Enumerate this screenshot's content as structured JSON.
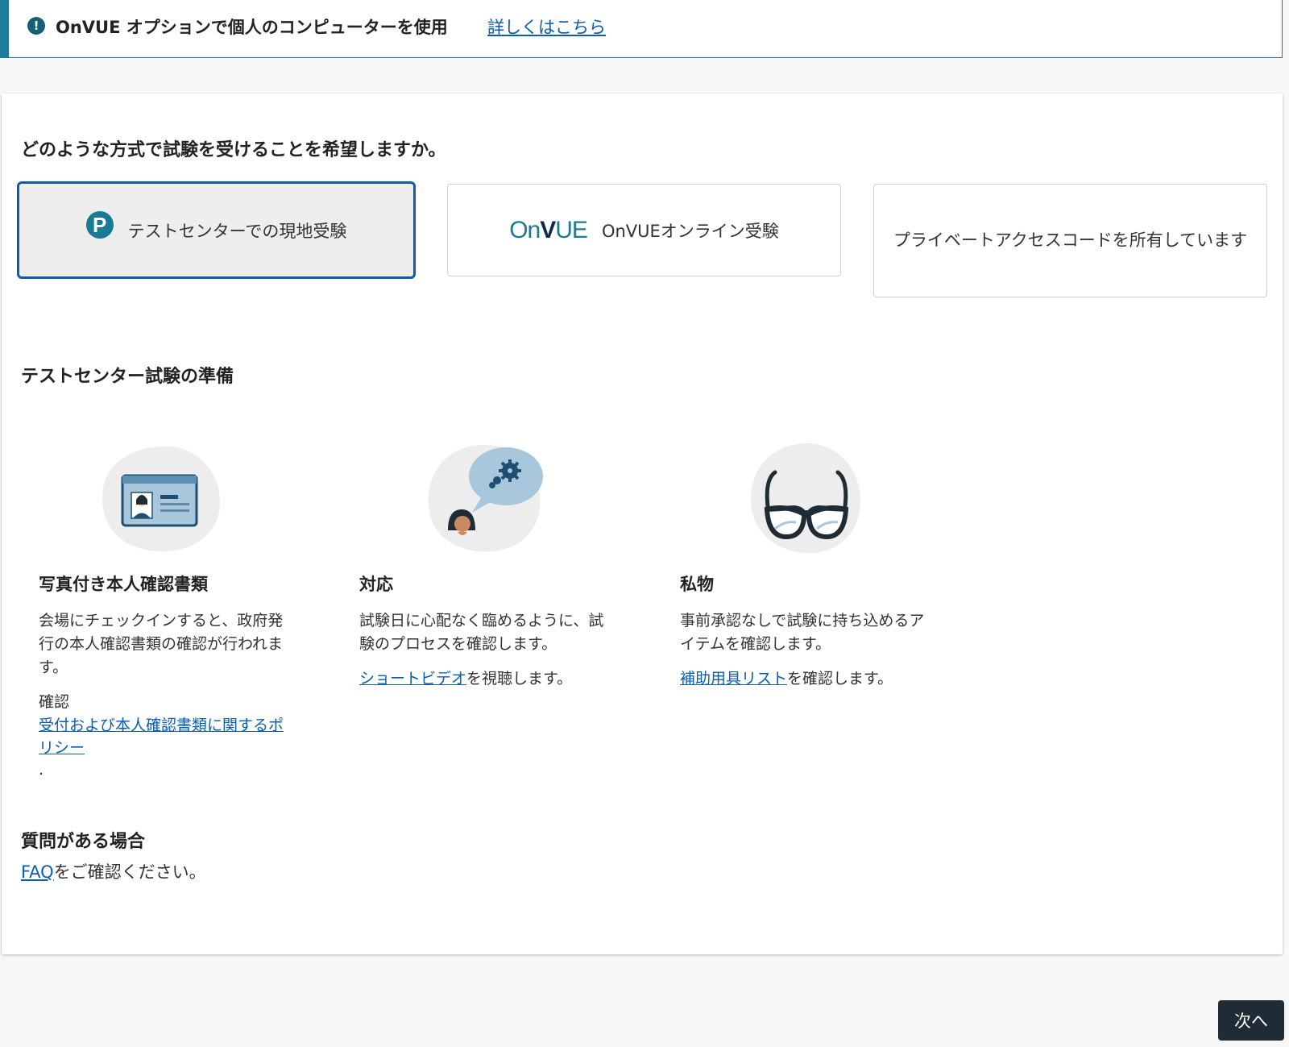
{
  "banner": {
    "text": "OnVUE オプションで個人のコンピューターを使用",
    "link": "詳しくはこちら",
    "icon": "exclamation-icon"
  },
  "question": "どのような方式で試験を受けることを希望しますか。",
  "options": [
    {
      "label": "テストセンターでの現地受験",
      "logo": "P",
      "selected": true
    },
    {
      "label": "OnVUEオンライン受験",
      "logo": "OnVUE",
      "selected": false
    },
    {
      "label": "プライベートアクセスコードを所有しています",
      "selected": false
    }
  ],
  "prep": {
    "title": "テストセンター試験の準備",
    "items": [
      {
        "icon": "id-card-icon",
        "title": "写真付き本人確認書類",
        "desc": "会場にチェックインすると、政府発行の本人確認書類の確認が行われます。",
        "confirm": "確認",
        "link": "受付および本人確認書類に関するポリシー",
        "after": "."
      },
      {
        "icon": "person-thinking-icon",
        "title": "対応",
        "desc": "試験日に心配なく臨めるように、試験のプロセスを確認します。",
        "link": "ショートビデオ",
        "after": "を視聴します。"
      },
      {
        "icon": "glasses-icon",
        "title": "私物",
        "desc": "事前承認なしで試験に持ち込めるアイテムを確認します。",
        "link": "補助用具リスト",
        "after": "を確認します。"
      }
    ]
  },
  "faq": {
    "title": "質問がある場合",
    "link": "FAQ",
    "after": "をご確認ください。"
  },
  "next_button": "次へ",
  "colors": {
    "accent": "#0a5db0",
    "banner_bar": "#1d7b9c",
    "button_bg": "#1f2b35"
  }
}
